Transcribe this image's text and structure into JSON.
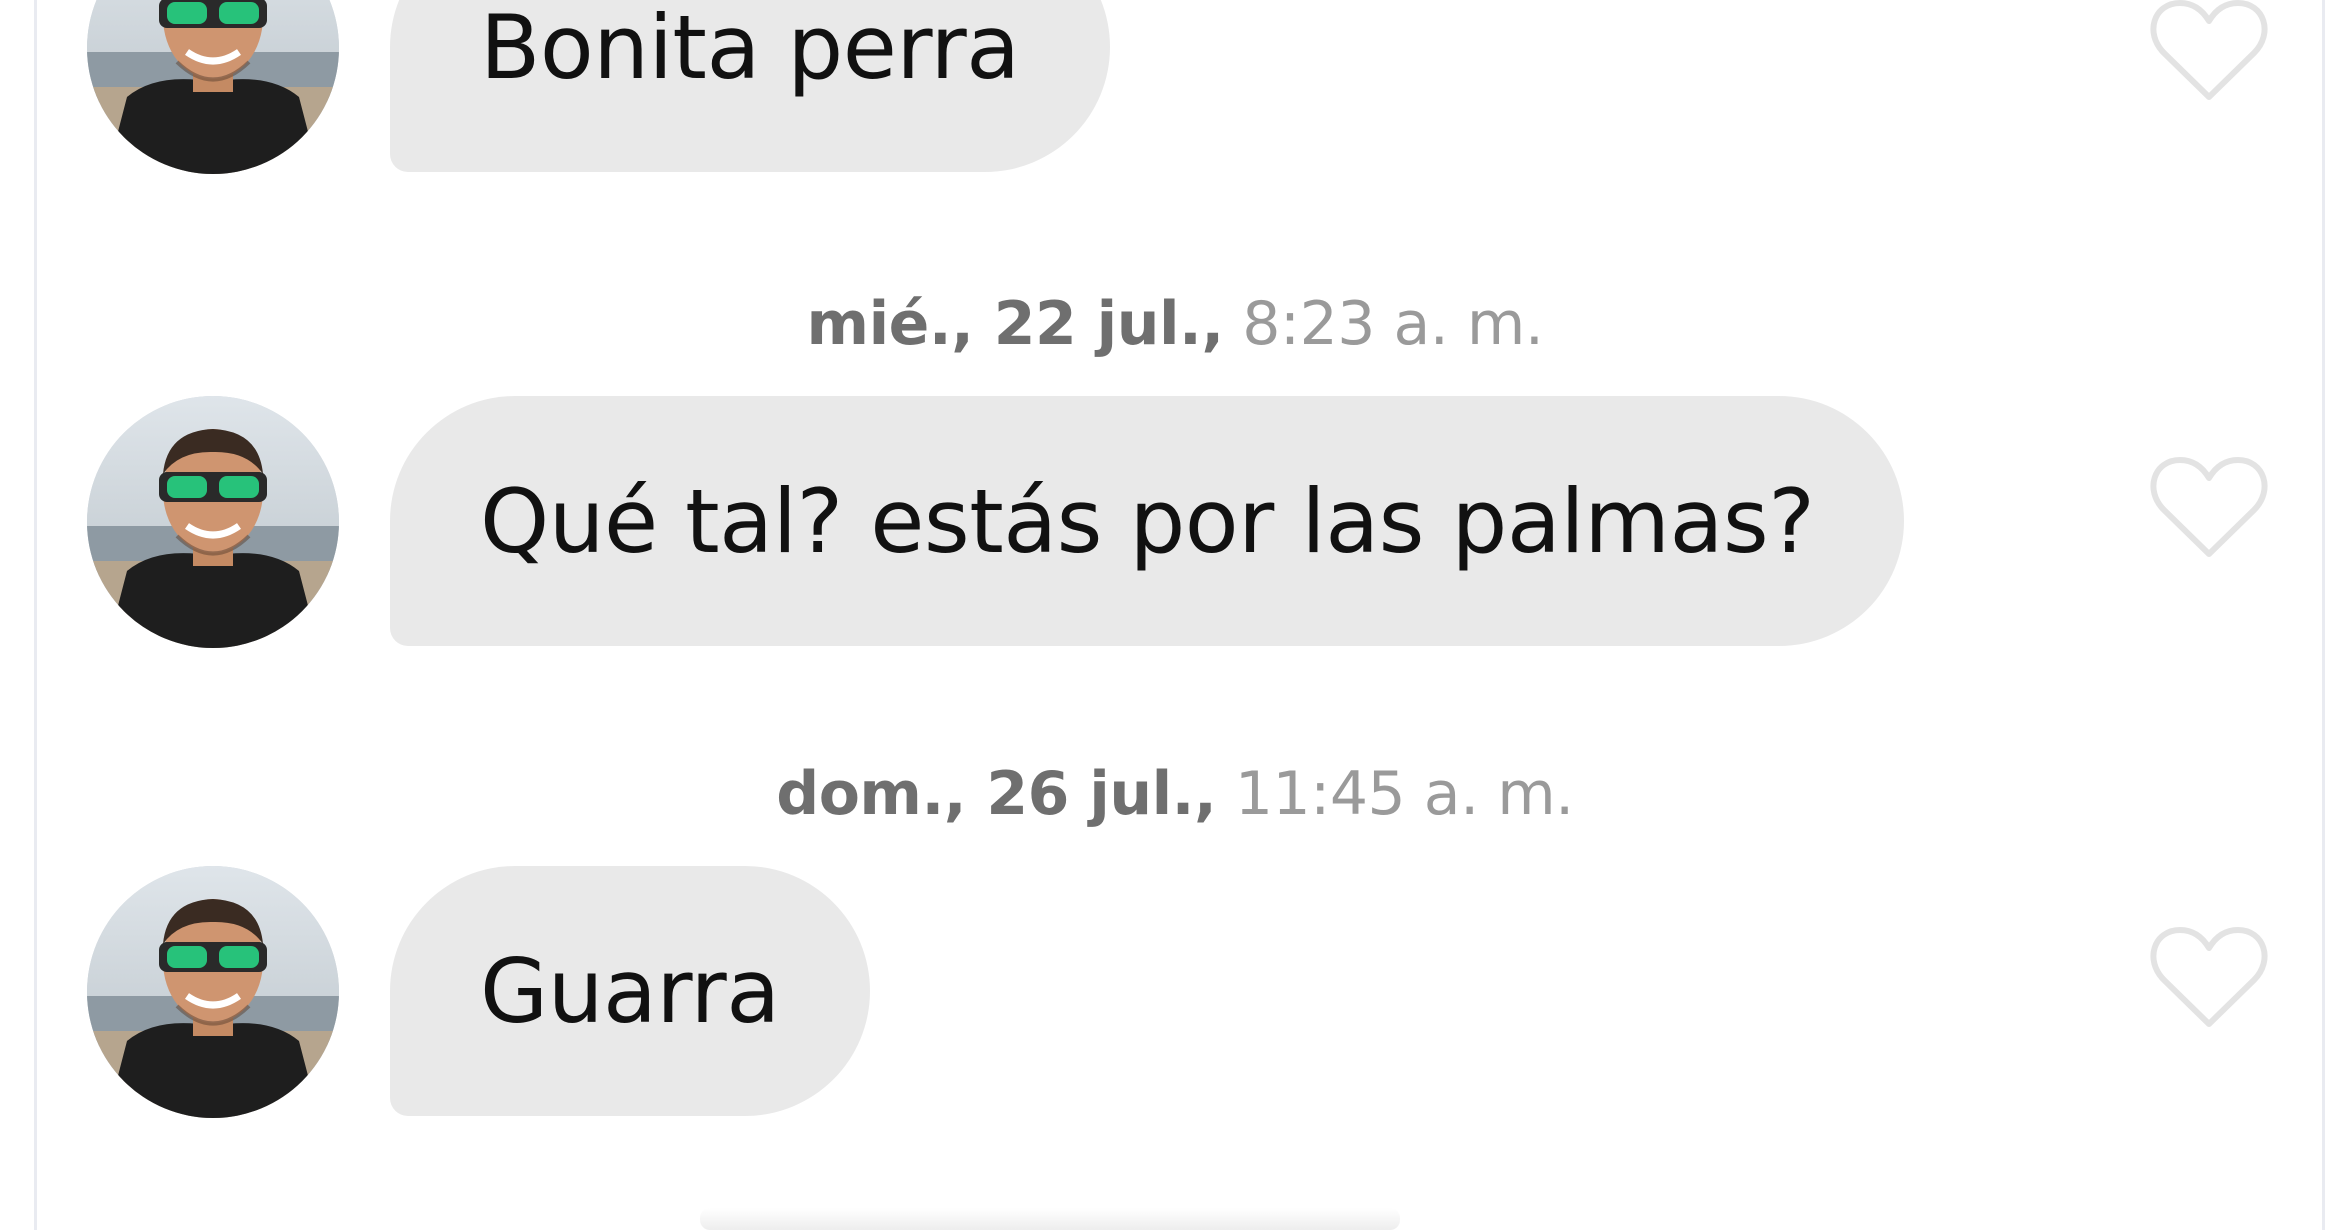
{
  "conversation": {
    "messages": [
      {
        "text": "Bonita perra",
        "liked": false
      },
      {
        "timestamp_date": "mié., 22 jul.,",
        "timestamp_time": "8:23 a. m.",
        "text": "Qué tal? estás por las palmas?",
        "liked": false
      },
      {
        "timestamp_date": "dom., 26 jul.,",
        "timestamp_time": "11:45 a. m.",
        "text": "Guarra",
        "liked": false
      }
    ]
  },
  "icons": {
    "avatar": "avatar-icon",
    "like": "heart-outline-icon"
  },
  "colors": {
    "bubble": "#e9e9e9",
    "timestamp": "#9a9a9a",
    "heart": "#e3e3e3",
    "frame": "#e9ebf1"
  }
}
